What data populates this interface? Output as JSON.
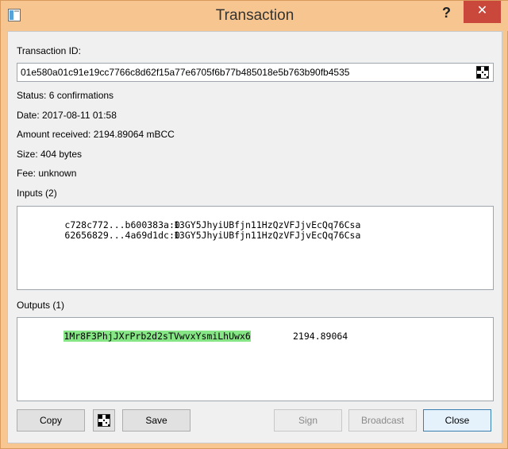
{
  "window": {
    "title": "Transaction",
    "help_label": "?",
    "close_label": "✕"
  },
  "transaction": {
    "id_label": "Transaction ID:",
    "id_value": "01e580a01c91e19cc7766c8d62f15a77e6705f6b77b485018e5b763b90fb4535",
    "status": "Status: 6 confirmations",
    "date": "Date: 2017-08-11 01:58",
    "amount": "Amount received: 2194.89064 mBCC",
    "size": "Size: 404 bytes",
    "fee": "Fee: unknown"
  },
  "inputs": {
    "label": "Inputs (2)",
    "rows": [
      {
        "outpoint": "c728c772...b600383a:0",
        "address": "13GY5JhyiUBfjn11HzQzVFJjvEcQq76Csa"
      },
      {
        "outpoint": "62656829...4a69d1dc:0",
        "address": "13GY5JhyiUBfjn11HzQzVFJjvEcQq76Csa"
      }
    ]
  },
  "outputs": {
    "label": "Outputs (1)",
    "rows": [
      {
        "address": "1Mr8F3PhjJXrPrb2d2sTVwvxYsmiLhUwx6",
        "amount": "2194.89064"
      }
    ]
  },
  "buttons": {
    "copy": "Copy",
    "save": "Save",
    "sign": "Sign",
    "broadcast": "Broadcast",
    "close": "Close"
  },
  "colors": {
    "titlebar": "#f7c690",
    "close_button": "#c9473b",
    "output_highlight": "#86e686"
  },
  "icons": {
    "app": "app-window-icon",
    "qr": "qr-code-icon"
  }
}
